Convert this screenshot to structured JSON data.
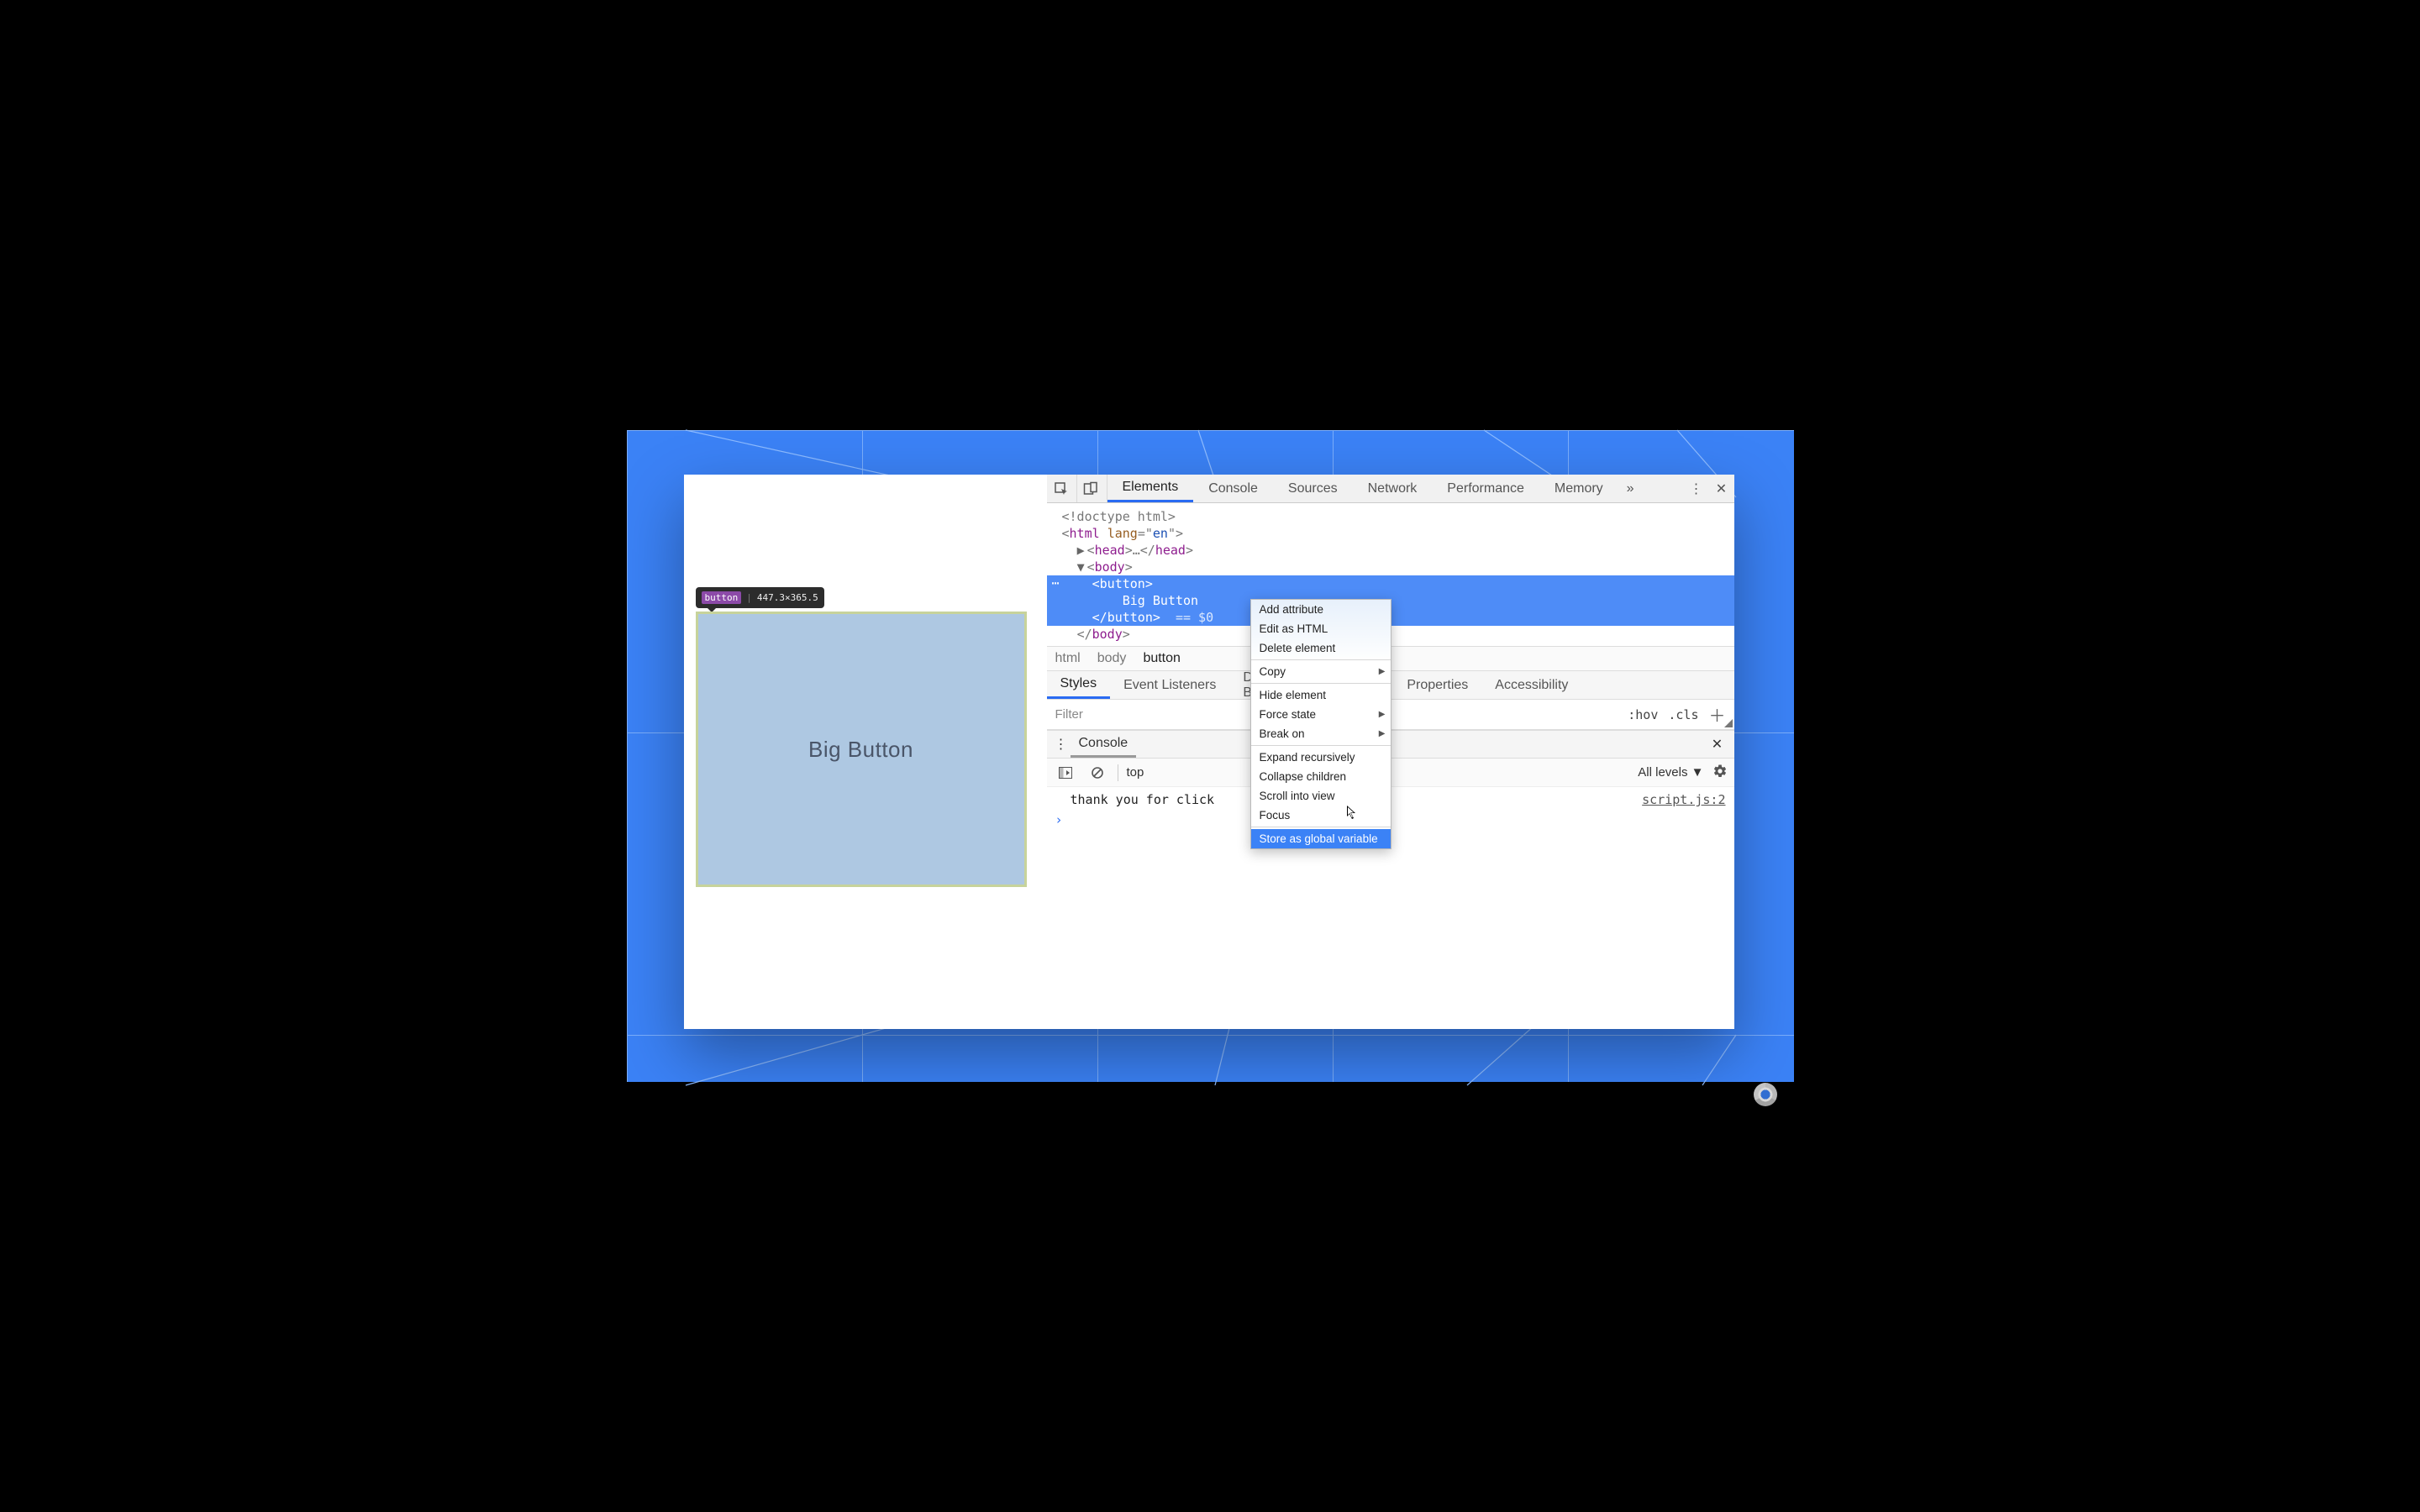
{
  "preview": {
    "inspect_tag": "button",
    "inspect_dims": "447.3×365.5",
    "big_button_label": "Big Button"
  },
  "devtools": {
    "tabs": [
      "Elements",
      "Console",
      "Sources",
      "Network",
      "Performance",
      "Memory"
    ],
    "active_tab": "Elements",
    "overflow_glyph": "»",
    "code": {
      "doctype": "<!doctype html>",
      "html_open": "<html lang=\"en\">",
      "head": "<head>…</head>",
      "body_open": "<body>",
      "btn_open": "<button>",
      "btn_text": "Big Button",
      "btn_close": "</button>",
      "ref": "== $0",
      "body_close": "</body>"
    },
    "breadcrumb": [
      "html",
      "body",
      "button"
    ],
    "sub_tabs": [
      "Styles",
      "Event Listeners",
      "DOM Breakpoints",
      "Properties",
      "Accessibility"
    ],
    "filter_placeholder": "Filter",
    "hov": ":hov",
    "cls": ".cls"
  },
  "console": {
    "drawer_label": "Console",
    "context": "top",
    "levels": "All levels ▼",
    "log_msg": "thank you for click",
    "log_src": "script.js:2",
    "prompt": "›"
  },
  "context_menu": {
    "items": [
      {
        "label": "Add attribute"
      },
      {
        "label": "Edit as HTML"
      },
      {
        "label": "Delete element"
      },
      {
        "sep": true
      },
      {
        "label": "Copy",
        "sub": true
      },
      {
        "sep": true
      },
      {
        "label": "Hide element"
      },
      {
        "label": "Force state",
        "sub": true
      },
      {
        "label": "Break on",
        "sub": true
      },
      {
        "sep": true
      },
      {
        "label": "Expand recursively"
      },
      {
        "label": "Collapse children"
      },
      {
        "label": "Scroll into view"
      },
      {
        "label": "Focus"
      },
      {
        "sep": true
      },
      {
        "label": "Store as global variable",
        "hover": true
      }
    ]
  }
}
